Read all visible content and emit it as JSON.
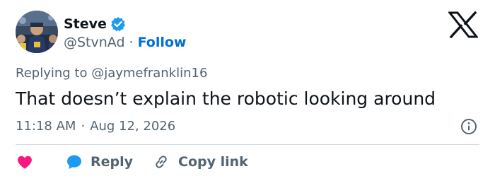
{
  "user": {
    "display_name": "Steve",
    "handle": "@StvnAd",
    "follow_label": "Follow",
    "separator": "·",
    "verified_icon": "verified-badge-icon"
  },
  "tweet": {
    "replying_prefix": "Replying to ",
    "replying_to": "@jaymefranklin16",
    "text": "That doesn’t explain the robotic looking around",
    "time": "11:18 AM",
    "date_separator": "·",
    "date": "Aug 12, 2026"
  },
  "actions": {
    "reply_label": "Reply",
    "copy_link_label": "Copy link"
  },
  "icons": {
    "brand": "x-logo-icon",
    "info": "info-icon",
    "like": "heart-icon",
    "reply": "reply-bubble-icon",
    "copy_link": "link-icon"
  },
  "colors": {
    "text_primary": "#0f1419",
    "text_secondary": "#536471",
    "follow_blue": "#006fd6",
    "verified_blue": "#1d9bf0",
    "heart_red": "#f91880",
    "divider": "#cfd9de"
  }
}
